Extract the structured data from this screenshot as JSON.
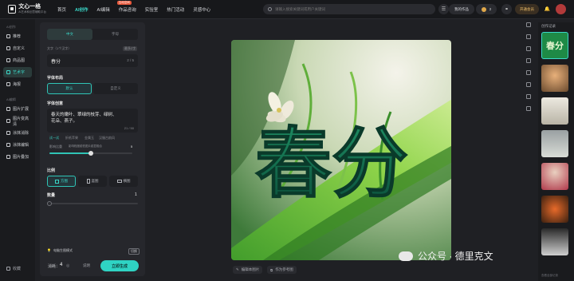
{
  "app": {
    "title": "文心一格",
    "subtitle": "AI艺术和创意辅助平台"
  },
  "nav": {
    "items": [
      "首页",
      "AI创作",
      "AI编辑",
      "作品咨询",
      "实验室",
      "热门活动",
      "灵感中心"
    ],
    "active_index": 1,
    "badge": "互动空间"
  },
  "search": {
    "placeholder": "请输入搜索关键词或用户关键词"
  },
  "topbar": {
    "works_button": "我的作品",
    "points": "2",
    "vip_button": "开通会员"
  },
  "sidebar": {
    "group1": "AI创作",
    "items": [
      "推荐",
      "自定义",
      "商品图",
      "艺术字",
      "海报"
    ],
    "active_index": 3,
    "group2": "AI编辑",
    "edit_items": [
      "图片扩展",
      "图片变高清",
      "涂抹消除",
      "涂抹编辑",
      "图片叠加"
    ],
    "bottom": "收藏"
  },
  "panel": {
    "tabs": [
      "中文",
      "字母"
    ],
    "active_tab": 0,
    "text_label": "文字（1个汉字）",
    "text_hint": "最多2字",
    "text_value": "春分",
    "text_count": "2 / 5",
    "layout_label": "字体布局",
    "layout_options": [
      "默认",
      "自定义"
    ],
    "creative_label": "字体创意",
    "creative_value": "春天的嫩叶、翠绿的枝芽、绿树、花朵、燕子。",
    "creative_count": "21 / 50",
    "try_label": "试一试",
    "try_items": [
      "折纸苹果",
      "金属玉",
      "汉服古韵风"
    ],
    "weight_label": "影响比重",
    "weight_hint": "影响程度越低图片越显融合",
    "weight_value": "5",
    "ratio_label": "比例",
    "ratio_options": [
      "方图",
      "竖图",
      "横图"
    ],
    "count_label": "数量",
    "count_value": "1",
    "mode_label": "电脑生图模式",
    "mode_hint": "切换",
    "cost_label": "消耗：",
    "cost_value": "4",
    "explain": "说明",
    "generate_button": "立即生成"
  },
  "canvas": {
    "art_text": "春分",
    "actions": [
      "编辑本图片",
      "作为参考图"
    ]
  },
  "history": {
    "title": "创作记录",
    "thumb_top_text": "春分",
    "footer": "查看全部记录"
  },
  "watermark": "公众号 · 德里克文"
}
